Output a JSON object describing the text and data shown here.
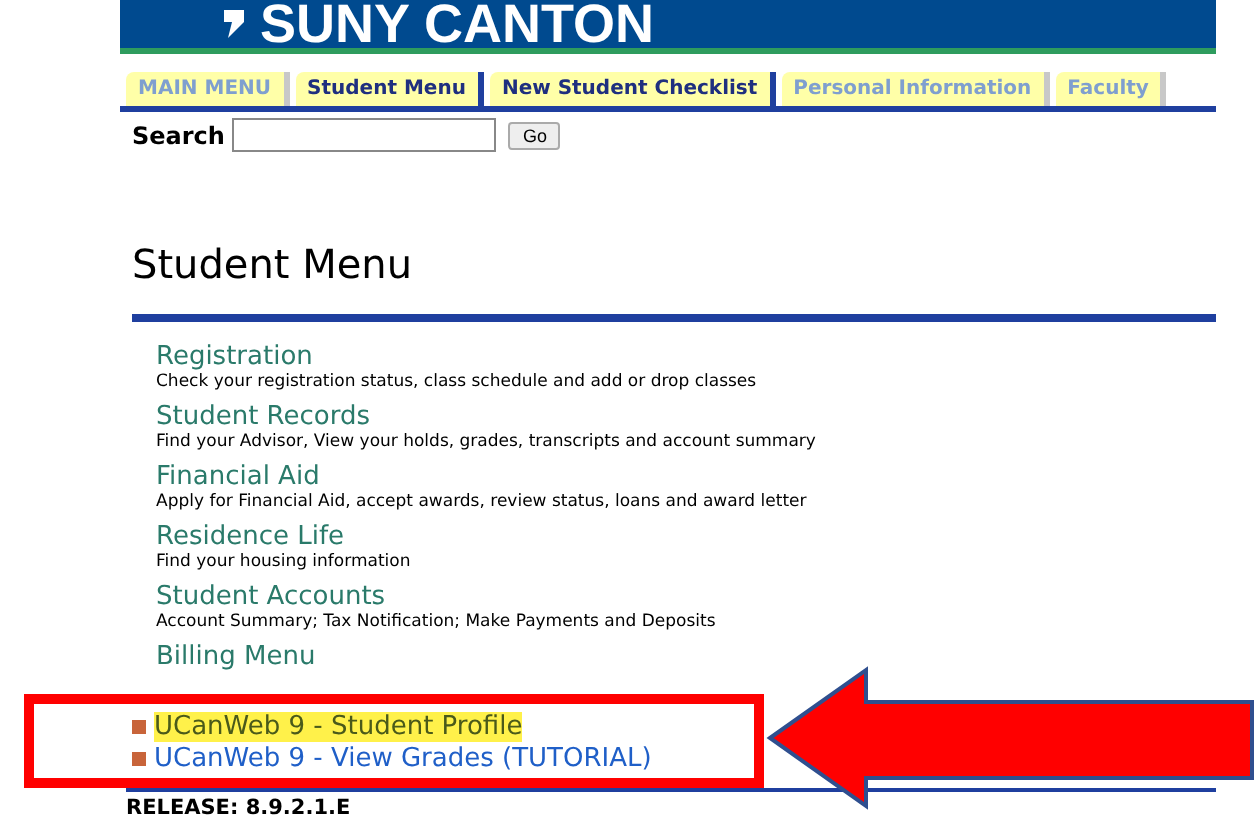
{
  "banner": {
    "logo": "SUNY CANTON"
  },
  "tabs": [
    {
      "label": "MAIN MENU",
      "dimmed": true
    },
    {
      "label": "Student Menu",
      "dimmed": false
    },
    {
      "label": "New Student Checklist",
      "dimmed": false
    },
    {
      "label": "Personal Information",
      "dimmed": true
    },
    {
      "label": "Faculty",
      "dimmed": true
    }
  ],
  "search": {
    "label": "Search",
    "button": "Go"
  },
  "heading": "Student Menu",
  "menu_items": [
    {
      "kind": "section",
      "title": "Registration",
      "description": "Check your registration status, class schedule and add or drop classes"
    },
    {
      "kind": "section",
      "title": "Student Records",
      "description": "Find your Advisor, View your holds, grades, transcripts and account summary"
    },
    {
      "kind": "section",
      "title": "Financial Aid",
      "description": "Apply for Financial Aid, accept awards, review status, loans and award letter"
    },
    {
      "kind": "section",
      "title": "Residence Life",
      "description": "Find your housing information"
    },
    {
      "kind": "section",
      "title": "Student Accounts",
      "description": "Account Summary; Tax Notification; Make Payments and Deposits"
    },
    {
      "kind": "section",
      "title": "Billing Menu"
    },
    {
      "kind": "bullet",
      "title": "UCanWeb 9 - Student Profile",
      "highlighted": true
    },
    {
      "kind": "bullet",
      "title": "UCanWeb 9 - View Grades (TUTORIAL)",
      "highlighted": false
    }
  ],
  "release": "RELEASE: 8.9.2.1.E"
}
